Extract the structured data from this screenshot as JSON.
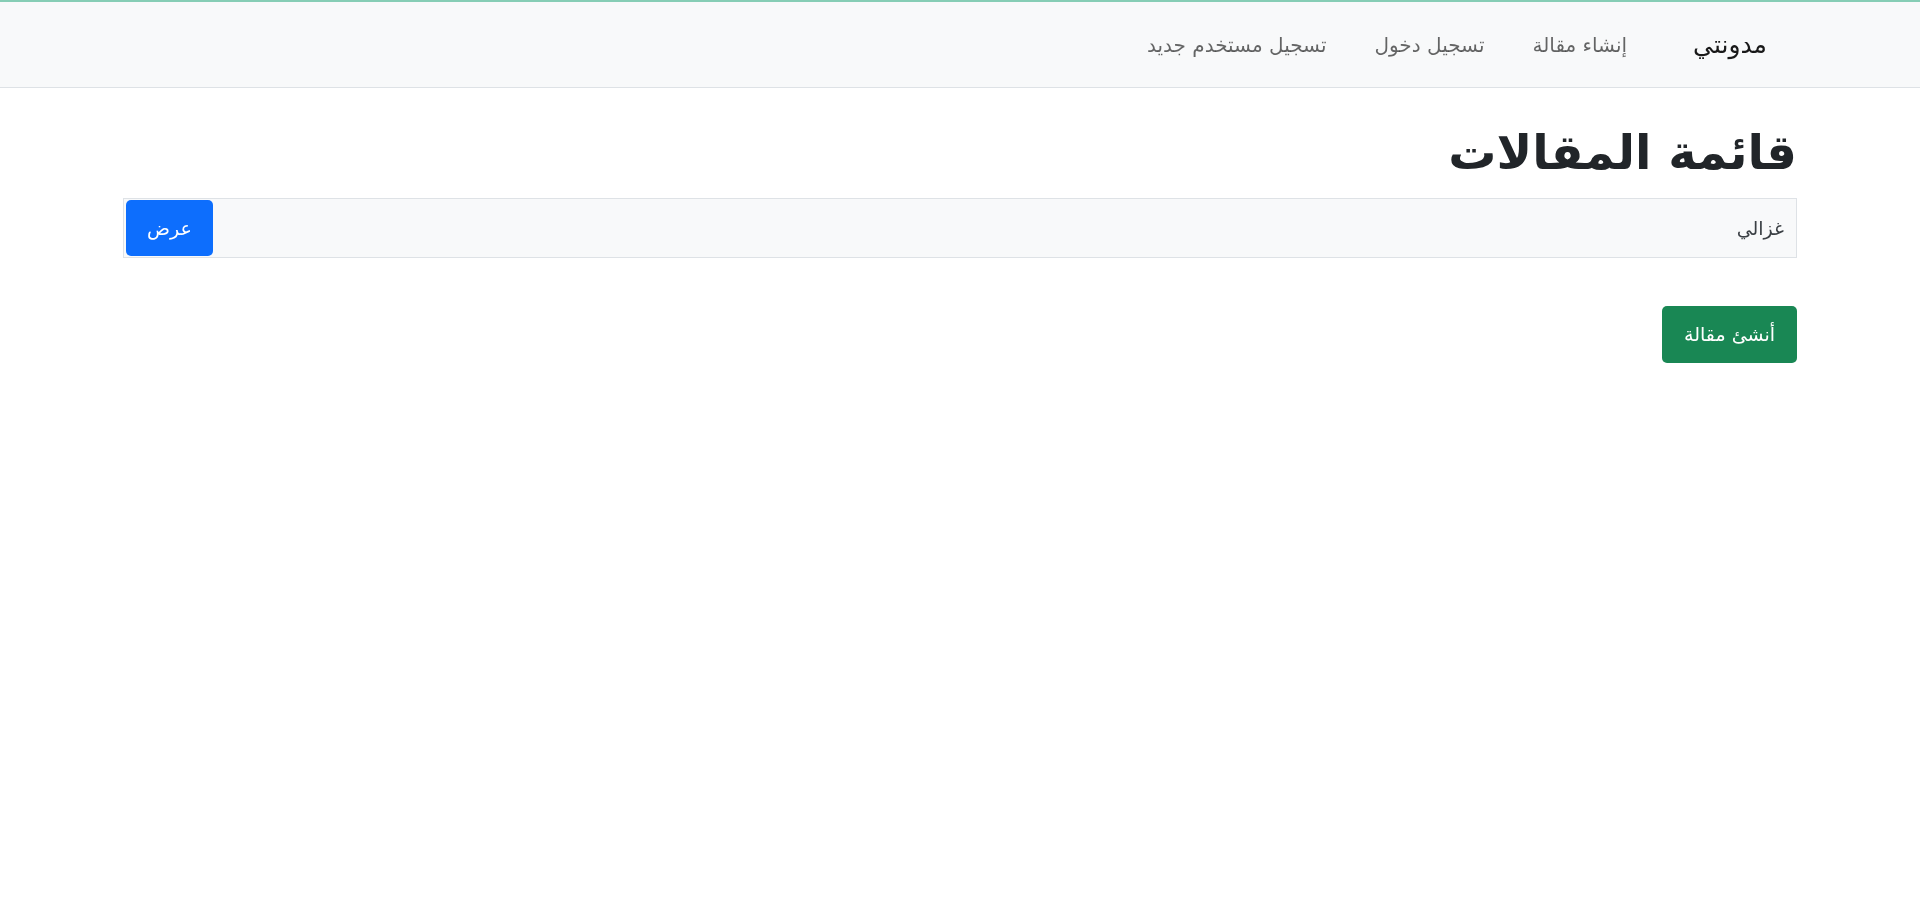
{
  "navbar": {
    "brand": "مدونتي",
    "links": [
      "إنشاء مقالة",
      "تسجيل دخول",
      "تسجيل مستخدم جديد"
    ]
  },
  "heading": "قائمة المقالات",
  "articles": [
    {
      "title": "غزالي",
      "button": "عرض"
    }
  ],
  "create_button": "أنشئ مقالة"
}
